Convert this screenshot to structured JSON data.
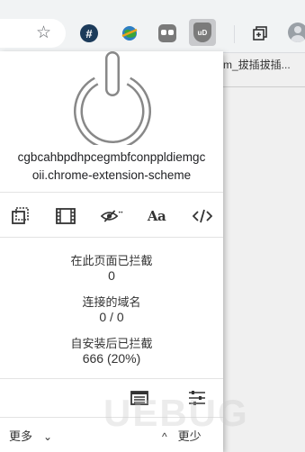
{
  "browser": {
    "background_title": "m_拔插拔插...",
    "extensions": [
      {
        "name": "hash-extension-icon",
        "glyph": "#"
      },
      {
        "name": "globe-extension-icon"
      },
      {
        "name": "gray-extension-icon"
      },
      {
        "name": "ublock-shield-icon",
        "glyph": "uD"
      },
      {
        "name": "tab-manager-icon"
      }
    ]
  },
  "popup": {
    "power_button": "power-icon",
    "hostname_line1": "cgbcahbpdhpcegmbfconppldiemgc",
    "hostname_line2": "oii.chrome-extension-scheme",
    "toolbar_icons": [
      "element-zapper-icon",
      "media-filter-icon",
      "cosmetic-filter-icon",
      "font-filter-icon",
      "script-filter-icon"
    ],
    "aa_label": "Aa",
    "stats": {
      "blocked_page_label": "在此页面已拦截",
      "blocked_page_value": "0",
      "domains_label": "连接的域名",
      "domains_value": "0 / 0",
      "blocked_total_label": "自安装后已拦截",
      "blocked_total_value": "666 (20%)"
    },
    "bottom_icons": [
      "logger-icon",
      "dashboard-settings-icon"
    ],
    "more_label": "更多",
    "less_label": "更少"
  },
  "watermark": "UEBUG",
  "colors": {
    "accent_gray": "#7b7b7b",
    "power_stroke": "#888888",
    "panel_bg": "#ffffff"
  }
}
